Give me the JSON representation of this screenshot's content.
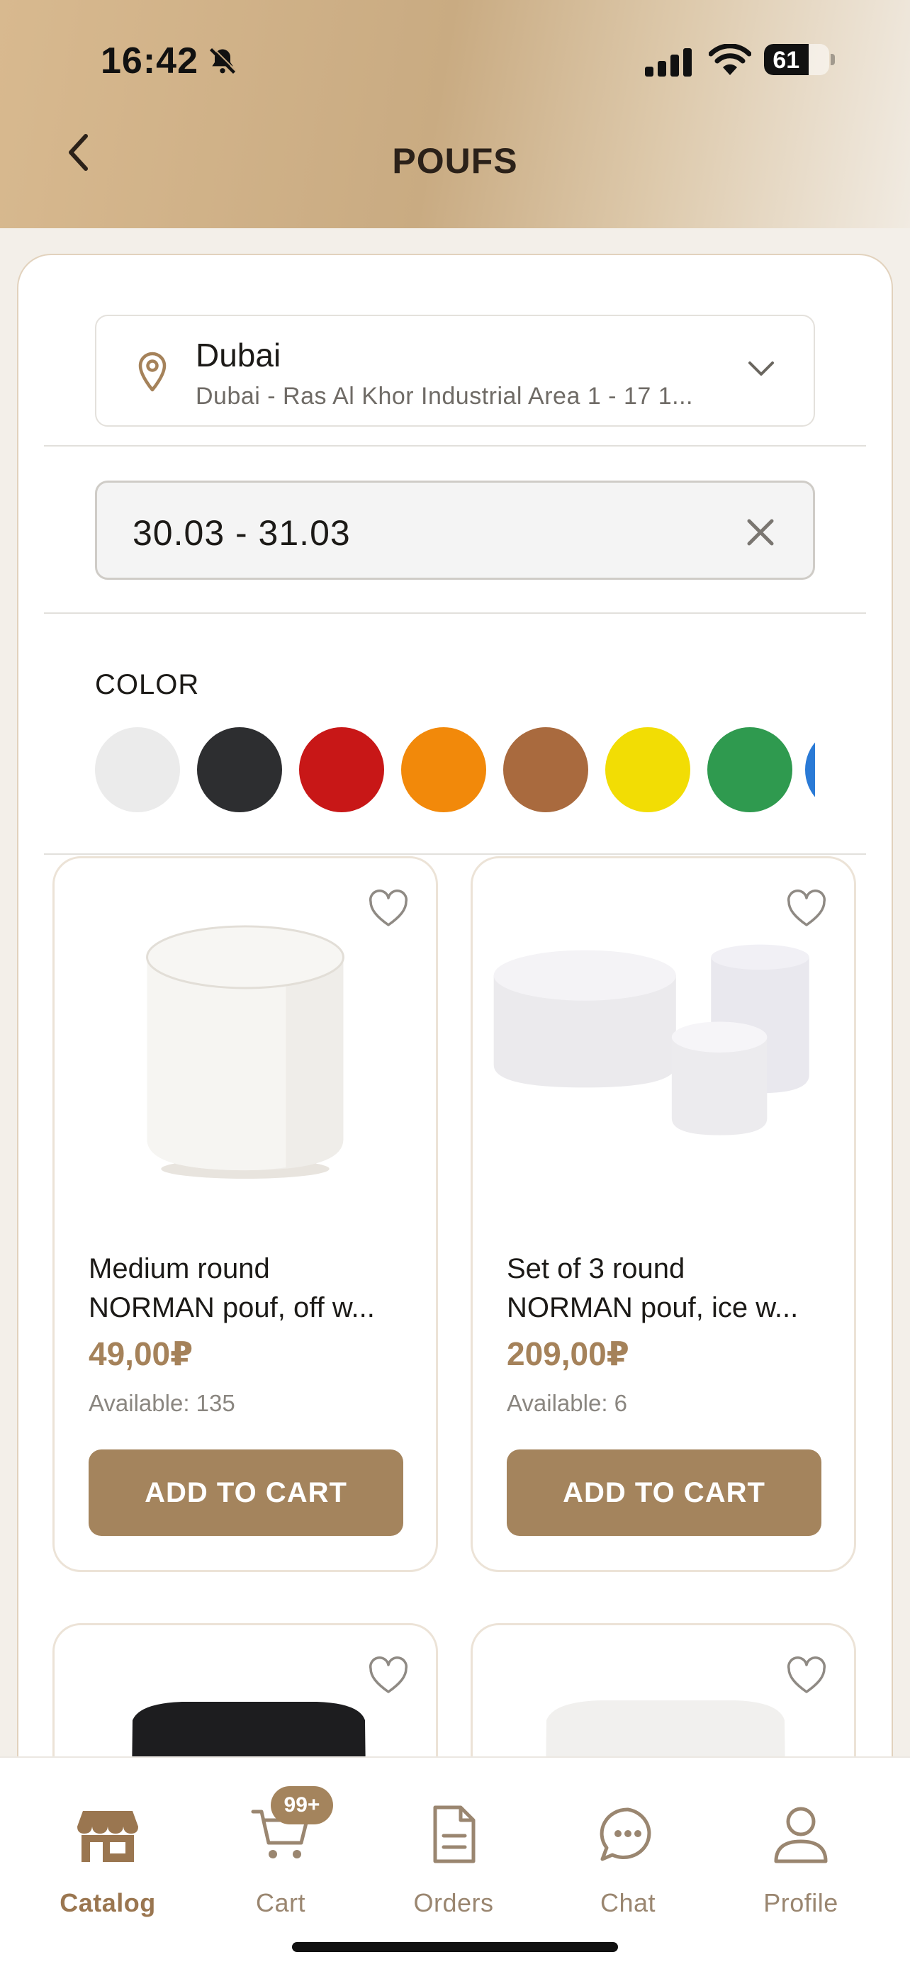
{
  "status_bar": {
    "time": "16:42",
    "battery": "61"
  },
  "header": {
    "title": "POUFS"
  },
  "location": {
    "city": "Dubai",
    "address": "Dubai - Ras Al Khor Industrial Area 1 - 17 1..."
  },
  "date_range": {
    "value": "30.03 - 31.03"
  },
  "color_filter": {
    "label": "COLOR",
    "swatches": [
      "#ebebeb",
      "#2d2e30",
      "#c81717",
      "#f2890a",
      "#a96a3e",
      "#f2dd04",
      "#2f9a4f",
      "#2a7ad6"
    ]
  },
  "products": [
    {
      "name_line1": "Medium round",
      "name_line2": "NORMAN pouf, off w...",
      "price": "49,00₽",
      "available": "Available: 135",
      "button": "ADD TO CART"
    },
    {
      "name_line1": "Set of 3 round",
      "name_line2": "NORMAN pouf, ice w...",
      "price": "209,00₽",
      "available": "Available: 6",
      "button": "ADD TO CART"
    }
  ],
  "tabbar": {
    "cart_badge": "99+",
    "tabs": [
      {
        "label": "Catalog",
        "icon": "store-icon",
        "active": true
      },
      {
        "label": "Cart",
        "icon": "cart-icon"
      },
      {
        "label": "Orders",
        "icon": "document-icon"
      },
      {
        "label": "Chat",
        "icon": "chat-bubble-icon"
      },
      {
        "label": "Profile",
        "icon": "person-icon"
      }
    ]
  },
  "colors": {
    "accent": "#a4845d",
    "price": "#a5825a"
  }
}
